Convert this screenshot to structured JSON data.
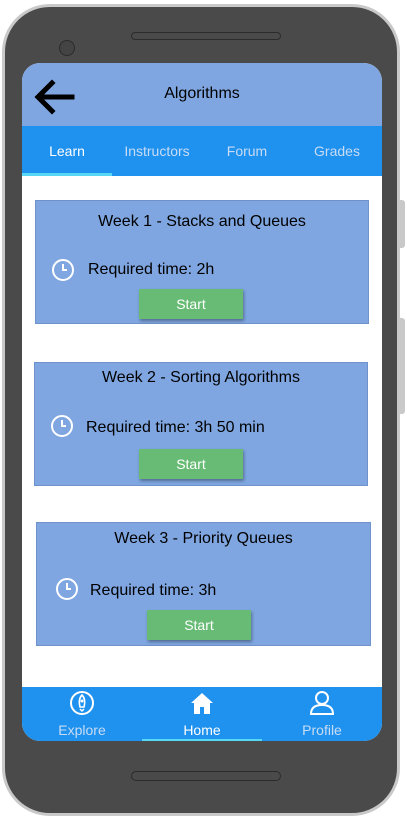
{
  "header": {
    "title": "Algorithms"
  },
  "tabs": [
    {
      "label": "Learn",
      "active": true
    },
    {
      "label": "Instructors",
      "active": false
    },
    {
      "label": "Forum",
      "active": false
    },
    {
      "label": "Grades",
      "active": false
    }
  ],
  "weeks": [
    {
      "title": "Week 1 - Stacks and Queues",
      "required_time": "Required time: 2h",
      "button_label": "Start"
    },
    {
      "title": "Week 2 - Sorting Algorithms",
      "required_time": "Required time: 3h 50 min",
      "button_label": "Start"
    },
    {
      "title": "Week 3 - Priority Queues",
      "required_time": "Required time: 3h",
      "button_label": "Start"
    }
  ],
  "bottom_nav": [
    {
      "label": "Explore",
      "icon": "rocket-icon",
      "active": false
    },
    {
      "label": "Home",
      "icon": "home-icon",
      "active": true
    },
    {
      "label": "Profile",
      "icon": "profile-icon",
      "active": false
    }
  ],
  "colors": {
    "header_bg": "#7fa6e0",
    "tab_bar_bg": "#1f91ee",
    "card_bg": "#7fa6e0",
    "start_button": "#67bb74",
    "active_indicator": "#56d8f5"
  }
}
